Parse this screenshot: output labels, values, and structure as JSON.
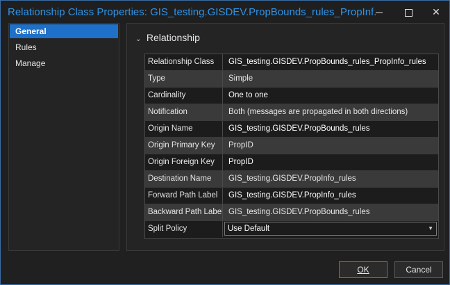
{
  "window": {
    "title": "Relationship Class Properties: GIS_testing.GISDEV.PropBounds_rules_PropInf..."
  },
  "titlebar_buttons": {
    "minimize_icon": "minimize-icon",
    "maximize_icon": "maximize-icon",
    "close_glyph": "✕"
  },
  "sidebar": {
    "items": [
      {
        "label": "General",
        "active": true
      },
      {
        "label": "Rules",
        "active": false
      },
      {
        "label": "Manage",
        "active": false
      }
    ]
  },
  "main": {
    "section_chevron": "⌄",
    "section_title": "Relationship",
    "rows": [
      {
        "label": "Relationship Class",
        "value": "GIS_testing.GISDEV.PropBounds_rules_PropInfo_rules"
      },
      {
        "label": "Type",
        "value": "Simple"
      },
      {
        "label": "Cardinality",
        "value": "One to one"
      },
      {
        "label": "Notification",
        "value": "Both (messages are propagated in both directions)"
      },
      {
        "label": "Origin Name",
        "value": "GIS_testing.GISDEV.PropBounds_rules"
      },
      {
        "label": "Origin Primary Key",
        "value": "PropID"
      },
      {
        "label": "Origin Foreign Key",
        "value": "PropID"
      },
      {
        "label": "Destination Name",
        "value": "GIS_testing.GISDEV.PropInfo_rules"
      },
      {
        "label": "Forward Path Label",
        "value": "GIS_testing.GISDEV.PropInfo_rules"
      },
      {
        "label": "Backward Path Label",
        "value": "GIS_testing.GISDEV.PropBounds_rules"
      },
      {
        "label": "Split Policy",
        "value": "Use Default"
      }
    ],
    "dropdown_arrow": "▼"
  },
  "footer": {
    "ok_label": "OK",
    "cancel_label": "Cancel"
  },
  "colors": {
    "accent": "#1e70c8",
    "title_text": "#2f93e8",
    "background": "#202020"
  }
}
